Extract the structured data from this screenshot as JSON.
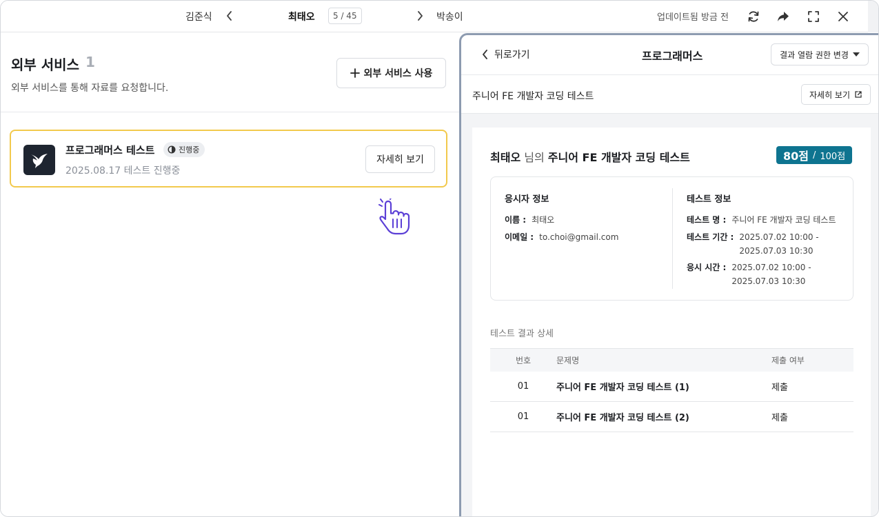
{
  "topbar": {
    "prev_name": "김준식",
    "current_name": "최태오",
    "counter": "5 / 45",
    "next_name": "박송이",
    "updated_text": "업데이트됨 방금 전"
  },
  "left_panel": {
    "title": "외부 서비스",
    "count": "1",
    "description": "외부 서비스를 통해 자료를 요청합니다.",
    "use_button": "외부 서비스 사용",
    "card": {
      "title": "프로그래머스 테스트",
      "status": "진행중",
      "date": "2025.08.17 테스트 진행중",
      "detail_button": "자세히 보기"
    }
  },
  "right_panel": {
    "back_label": "뒤로가기",
    "title": "프로그래머스",
    "permission_button": "결과 열람 권한 변경",
    "test_name": "주니어 FE 개발자 코딩 테스트",
    "detail_button": "자세히 보기",
    "report": {
      "candidate": "최태오",
      "nim_text": " 님의 ",
      "test_title": "주니어 FE 개발자 코딩 테스트",
      "score": "80점",
      "score_sep": "/",
      "score_total": "100점",
      "candidate_info_title": "응시자 정보",
      "name_label": "이름 :",
      "name_value": "최태오",
      "email_label": "이메일 :",
      "email_value": "to.choi@gmail.com",
      "test_info_title": "테스트 정보",
      "test_name_label": "테스트 명 :",
      "test_name_value": "주니어 FE 개발자 코딩 테스트",
      "period_label": "테스트 기간 :",
      "period_value_1": "2025.07.02 10:00 -",
      "period_value_2": "2025.07.03 10:30",
      "taken_label": "응시 시간 :",
      "taken_value_1": "2025.07.02 10:00 -",
      "taken_value_2": "2025.07.03 10:30",
      "section_label": "테스트 결과 상세",
      "table": {
        "headers": [
          "번호",
          "문제명",
          "제출 여부"
        ],
        "rows": [
          {
            "no": "01",
            "name": "주니어 FE 개발자 코딩 테스트 (1)",
            "submitted": "제출"
          },
          {
            "no": "01",
            "name": "주니어 FE 개발자 코딩 테스트 (2)",
            "submitted": "제출"
          }
        ]
      }
    }
  },
  "colors": {
    "accent_score": "#0e7490",
    "card_highlight": "#f2c94c",
    "panel_border": "#8d9bb0",
    "cursor": "#5b3fd6"
  },
  "icons": [
    "chevron-left-icon",
    "chevron-right-icon",
    "refresh-icon",
    "share-icon",
    "fullscreen-icon",
    "close-icon",
    "plus-icon",
    "hummingbird-logo-icon",
    "half-circle-status-icon",
    "external-link-icon",
    "caret-down-icon",
    "hand-pointer-icon"
  ]
}
